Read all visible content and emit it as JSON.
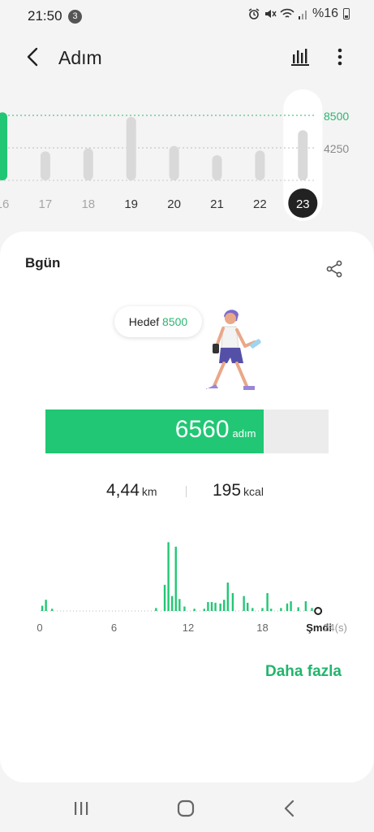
{
  "status_bar": {
    "time": "21:50",
    "notification_count": "3",
    "battery": "%16",
    "icons": [
      "alarm-icon",
      "mute-icon",
      "wifi-icon",
      "signal-icon",
      "battery-icon"
    ]
  },
  "app_bar": {
    "title": "Adım",
    "icons": [
      "back-arrow-icon",
      "bar-chart-icon",
      "more-vert-icon"
    ]
  },
  "weekly_chart": {
    "goal_label": "8500",
    "half_goal_label": "4250",
    "goal": 8500,
    "days": [
      {
        "label": "16",
        "steps": 8900,
        "reached": true
      },
      {
        "label": "17",
        "steps": 3800,
        "reached": false
      },
      {
        "label": "18",
        "steps": 4200,
        "reached": false
      },
      {
        "label": "19",
        "steps": 8300,
        "reached": false
      },
      {
        "label": "20",
        "steps": 4500,
        "reached": false
      },
      {
        "label": "21",
        "steps": 3300,
        "reached": false
      },
      {
        "label": "22",
        "steps": 3900,
        "reached": false
      },
      {
        "label": "23",
        "steps": 6560,
        "reached": false,
        "selected": true
      }
    ],
    "colors": {
      "reached": "#21c774",
      "normal": "#d9d9d9",
      "selected": "#222222",
      "goal_line": "#2bb673"
    }
  },
  "summary": {
    "title": "Bgün",
    "goal_text": "Hedef",
    "goal_value": "8500",
    "steps_value": "6560",
    "steps_unit": "adım",
    "progress_fraction": 0.772,
    "distance_value": "4,44",
    "distance_unit": "km",
    "calories_value": "195",
    "calories_unit": "kcal",
    "icons": [
      "share-icon",
      "walking-person-illustration"
    ]
  },
  "hourly_chart": {
    "tick_labels": [
      "0",
      "6",
      "12",
      "18"
    ],
    "now_label": "Şmdi",
    "end_label": "24(s)",
    "now_hour": 22.5,
    "hours_total": 24,
    "bars": [
      [
        0.2,
        7
      ],
      [
        0.5,
        15
      ],
      [
        1.0,
        3
      ],
      [
        9.4,
        4
      ],
      [
        10.1,
        35
      ],
      [
        10.4,
        92
      ],
      [
        10.7,
        20
      ],
      [
        11.0,
        86
      ],
      [
        11.3,
        16
      ],
      [
        11.7,
        6
      ],
      [
        12.5,
        3
      ],
      [
        13.3,
        3
      ],
      [
        13.6,
        12
      ],
      [
        13.9,
        12
      ],
      [
        14.2,
        11
      ],
      [
        14.6,
        10
      ],
      [
        14.9,
        15
      ],
      [
        15.2,
        38
      ],
      [
        15.6,
        24
      ],
      [
        16.5,
        20
      ],
      [
        16.8,
        11
      ],
      [
        17.2,
        4
      ],
      [
        18.0,
        4
      ],
      [
        18.4,
        24
      ],
      [
        18.7,
        3
      ],
      [
        19.5,
        4
      ],
      [
        20.0,
        10
      ],
      [
        20.3,
        13
      ],
      [
        20.9,
        5
      ],
      [
        21.5,
        13
      ],
      [
        22.0,
        4
      ]
    ],
    "color": "#21c774"
  },
  "more_link": "Daha fazla",
  "nav_bar": {
    "icons": [
      "recents-icon",
      "home-icon",
      "nav-back-icon"
    ]
  }
}
